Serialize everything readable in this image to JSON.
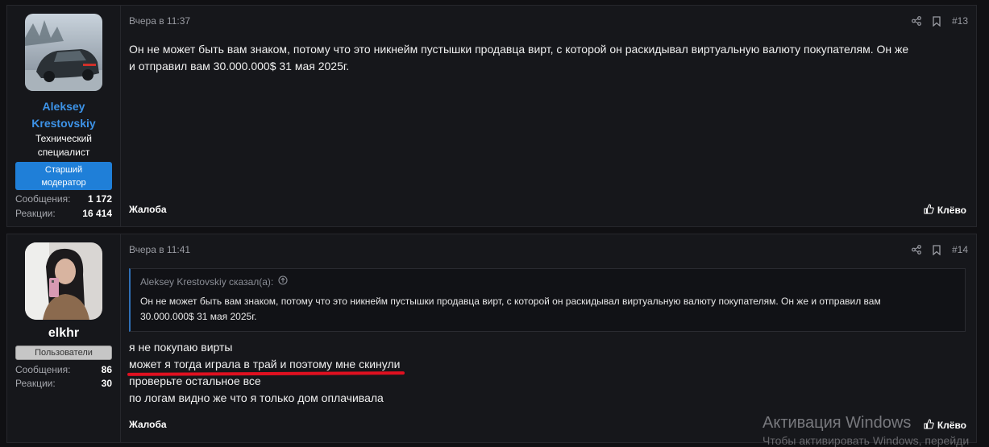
{
  "posts": [
    {
      "user": {
        "name_line1": "Aleksey",
        "name_line2": "Krestovskiy",
        "title_line1": "Технический",
        "title_line2": "специалист",
        "badge_line1": "Старший",
        "badge_line2": "модератор",
        "stats": [
          {
            "label": "Сообщения:",
            "value": "1 172"
          },
          {
            "label": "Реакции:",
            "value": "16 414"
          }
        ]
      },
      "time": "Вчера в 11:37",
      "number": "#13",
      "body_line1": "Он не может быть вам знаком, потому что это никнейм пустышки продавца вирт, с которой он раскидывал виртуальную валюту покупателям. Он же",
      "body_line2": "и отправил вам 30.000.000$ 31 мая 2025г.",
      "report_label": "Жалоба",
      "like_label": "Клёво"
    },
    {
      "user": {
        "name": "elkhr",
        "badge": "Пользователи",
        "stats": [
          {
            "label": "Сообщения:",
            "value": "86"
          },
          {
            "label": "Реакции:",
            "value": "30"
          }
        ]
      },
      "time": "Вчера в 11:41",
      "number": "#14",
      "quote": {
        "author": "Aleksey Krestovskiy сказал(а):",
        "line1": "Он не может быть вам знаком, потому что это никнейм пустышки продавца вирт, с которой он раскидывал виртуальную валюту покупателям. Он же и отправил вам",
        "line2": "30.000.000$ 31 мая 2025г."
      },
      "lines": [
        "я не покупаю вирты",
        "может я тогда играла в трай и поэтому мне скинули",
        "проверьте остальное все",
        "по логам видно же что я только дом оплачивала"
      ],
      "report_label": "Жалоба",
      "like_label": "Клёво"
    }
  ],
  "watermark": {
    "title": "Активация Windows",
    "subtitle": "Чтобы активировать Windows, перейди"
  },
  "icons": [
    "share-icon",
    "bookmark-icon",
    "like-icon",
    "quote-arrow-icon"
  ],
  "colors": {
    "accent": "#3d93e8",
    "moderator_badge": "#1f7fd8",
    "underline": "#e01020"
  }
}
